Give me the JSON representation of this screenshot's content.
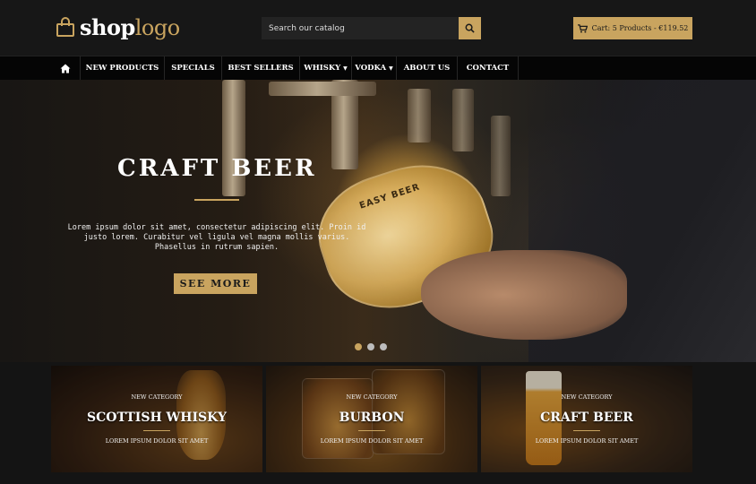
{
  "header": {
    "logo": {
      "part1": "shop",
      "part2": "logo"
    },
    "search": {
      "placeholder": "Search our catalog"
    },
    "cart": {
      "label": "Cart: 5 Products - €119.52"
    }
  },
  "nav": {
    "items": [
      {
        "label": "NEW PRODUCTS",
        "has_dropdown": false
      },
      {
        "label": "SPECIALS",
        "has_dropdown": false
      },
      {
        "label": "BEST SELLERS",
        "has_dropdown": false
      },
      {
        "label": "WHISKY",
        "has_dropdown": true
      },
      {
        "label": "VODKA",
        "has_dropdown": true
      },
      {
        "label": "ABOUT US",
        "has_dropdown": false
      },
      {
        "label": "CONTACT",
        "has_dropdown": false
      }
    ]
  },
  "hero": {
    "title": "CRAFT BEER",
    "text": "Lorem ipsum dolor sit amet, consectetur adipiscing elit. Proin id justo lorem. Curabitur vel ligula vel magna mollis varius. Phasellus in rutrum sapien.",
    "button": "SEE MORE",
    "glass_mark": "EASY BEER",
    "slides": 3,
    "active_slide": 1
  },
  "categories": [
    {
      "small": "NEW CATEGORY",
      "title": "SCOTTISH WHISKY",
      "sub": "LOREM IPSUM DOLOR SIT AMET"
    },
    {
      "small": "NEW CATEGORY",
      "title": "BURBON",
      "sub": "LOREM IPSUM DOLOR SIT AMET"
    },
    {
      "small": "NEW CATEGORY",
      "title": "CRAFT BEER",
      "sub": "LOREM IPSUM DOLOR SIT AMET"
    }
  ],
  "colors": {
    "accent": "#c9a45f",
    "background": "#141414",
    "nav": "#050505"
  },
  "icons": {
    "logo": "shopping-bag-icon",
    "search": "search-icon",
    "cart": "cart-icon",
    "home": "home-icon",
    "dropdown": "chevron-down-icon"
  }
}
